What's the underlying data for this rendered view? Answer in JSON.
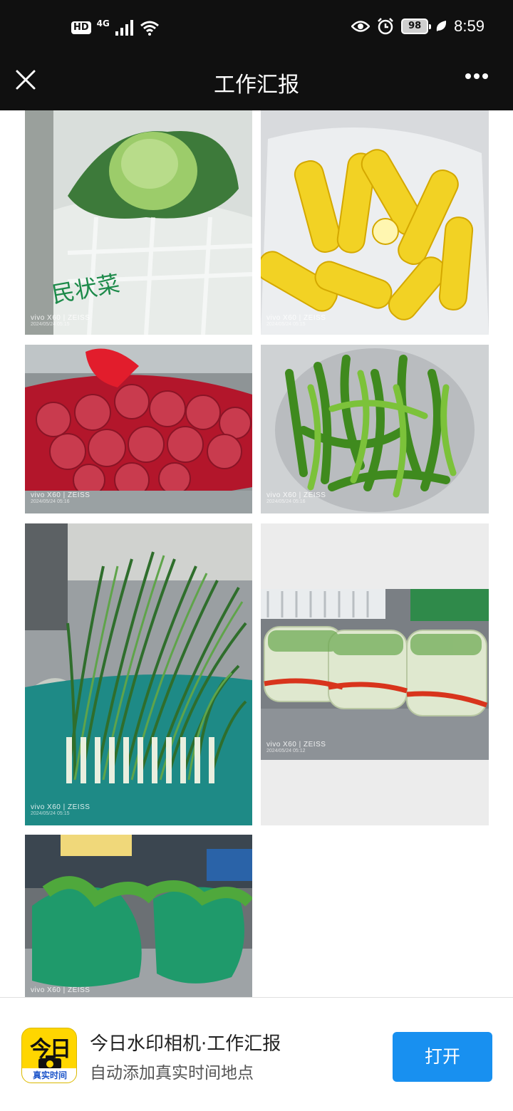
{
  "status_bar": {
    "hd": "HD",
    "network": "4G",
    "battery": "98",
    "time": "8:59"
  },
  "nav": {
    "title": "工作汇报"
  },
  "photos": [
    {
      "subject": "cabbage",
      "watermark_brand": "vivo X60 | ZEISS",
      "watermark_date": "2024/05/24 05:15"
    },
    {
      "subject": "corn",
      "watermark_brand": "vivo X60 | ZEISS",
      "watermark_date": "2024/05/24 05:15"
    },
    {
      "subject": "red onions",
      "watermark_brand": "vivo X60 | ZEISS",
      "watermark_date": "2024/05/24 05:16"
    },
    {
      "subject": "green peppers",
      "watermark_brand": "vivo X60 | ZEISS",
      "watermark_date": "2024/05/24 05:16"
    },
    {
      "subject": "green onions",
      "watermark_brand": "vivo X60 | ZEISS",
      "watermark_date": "2024/05/24 05:15"
    },
    {
      "subject": "celery in bags",
      "watermark_brand": "vivo X60 | ZEISS",
      "watermark_date": "2024/05/24 05:12"
    },
    {
      "subject": "leafy greens in bags",
      "watermark_brand": "vivo X60 | ZEISS",
      "watermark_date": ""
    }
  ],
  "banner": {
    "app_name": "今日水印相机·工作汇报",
    "app_desc": "自动添加真实时间地点",
    "open_label": "打开",
    "icon_text": "今日",
    "icon_strip": "真实时间",
    "accent_color": "#1890f0",
    "icon_color": "#ffd600"
  }
}
